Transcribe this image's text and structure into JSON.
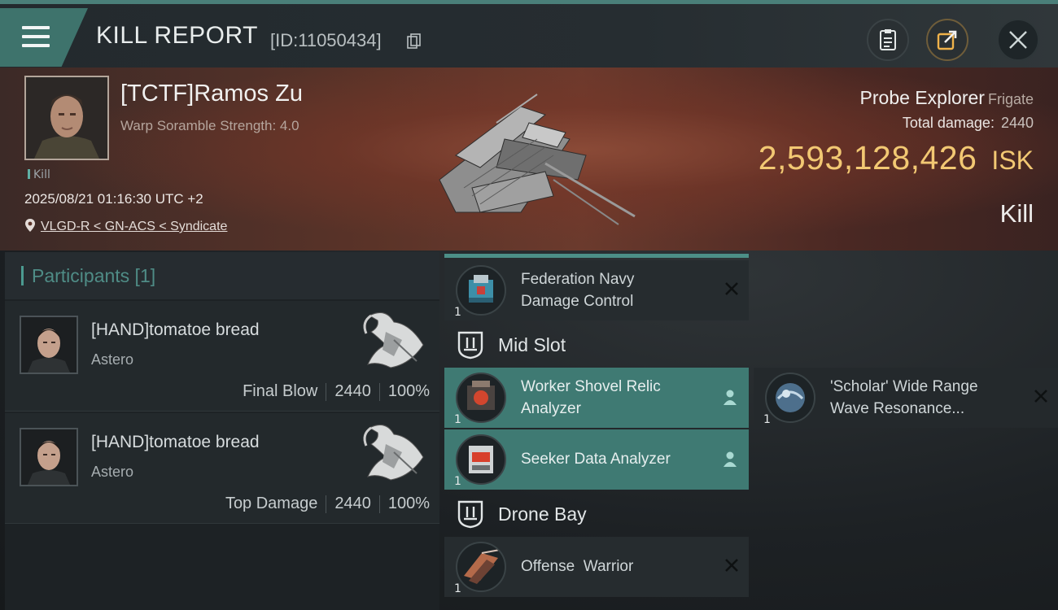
{
  "header": {
    "title": "KILL REPORT",
    "report_id": "[ID:11050434]",
    "menu_icon": "hamburger-menu-icon",
    "actions": [
      "clipboard-icon",
      "share-icon",
      "close-icon"
    ]
  },
  "victim": {
    "name": "[TCTF]Ramos Zu",
    "warp_scramble": "Warp Soramble Strength: 4.0",
    "kill_tag": "Kill",
    "datetime": "2025/08/21 01:16:30 UTC +2",
    "location": "VLGD-R < GN-ACS < Syndicate",
    "ship_name": "Probe Explorer",
    "ship_class": "Frigate",
    "total_damage_label": "Total damage:",
    "total_damage": "2440",
    "isk_value": "2,593,128,426",
    "isk_unit": "ISK",
    "result": "Kill"
  },
  "participants": {
    "title": "Participants [1]",
    "list": [
      {
        "name": "[HAND]tomatoe bread",
        "ship": "Astero",
        "role": "Final Blow",
        "damage": "2440",
        "percent": "100%"
      },
      {
        "name": "[HAND]tomatoe bread",
        "ship": "Astero",
        "role": "Top Damage",
        "damage": "2440",
        "percent": "100%"
      }
    ]
  },
  "fitting": {
    "low_items": [
      {
        "line1": "Federation Navy",
        "line2": "Damage Control",
        "qty": "1",
        "state": "destroyed"
      }
    ],
    "mid_slot_title": "Mid Slot",
    "mid_items": [
      {
        "line1": "Worker Shovel Relic",
        "line2": "Analyzer",
        "qty": "1",
        "state": "dropped"
      },
      {
        "line1": "'Scholar' Wide Range",
        "line2": "Wave Resonance...",
        "qty": "1",
        "state": "destroyed"
      },
      {
        "line1": "Seeker Data Analyzer",
        "line2": "",
        "qty": "1",
        "state": "dropped"
      }
    ],
    "drone_bay_title": "Drone Bay",
    "drone_items": [
      {
        "line1": "Offense  Warrior",
        "line2": "",
        "qty": "1",
        "state": "destroyed"
      }
    ]
  },
  "colors": {
    "accent": "#4b9a90",
    "isk": "#f2c873",
    "dropped_bg": "#3f7a73"
  }
}
